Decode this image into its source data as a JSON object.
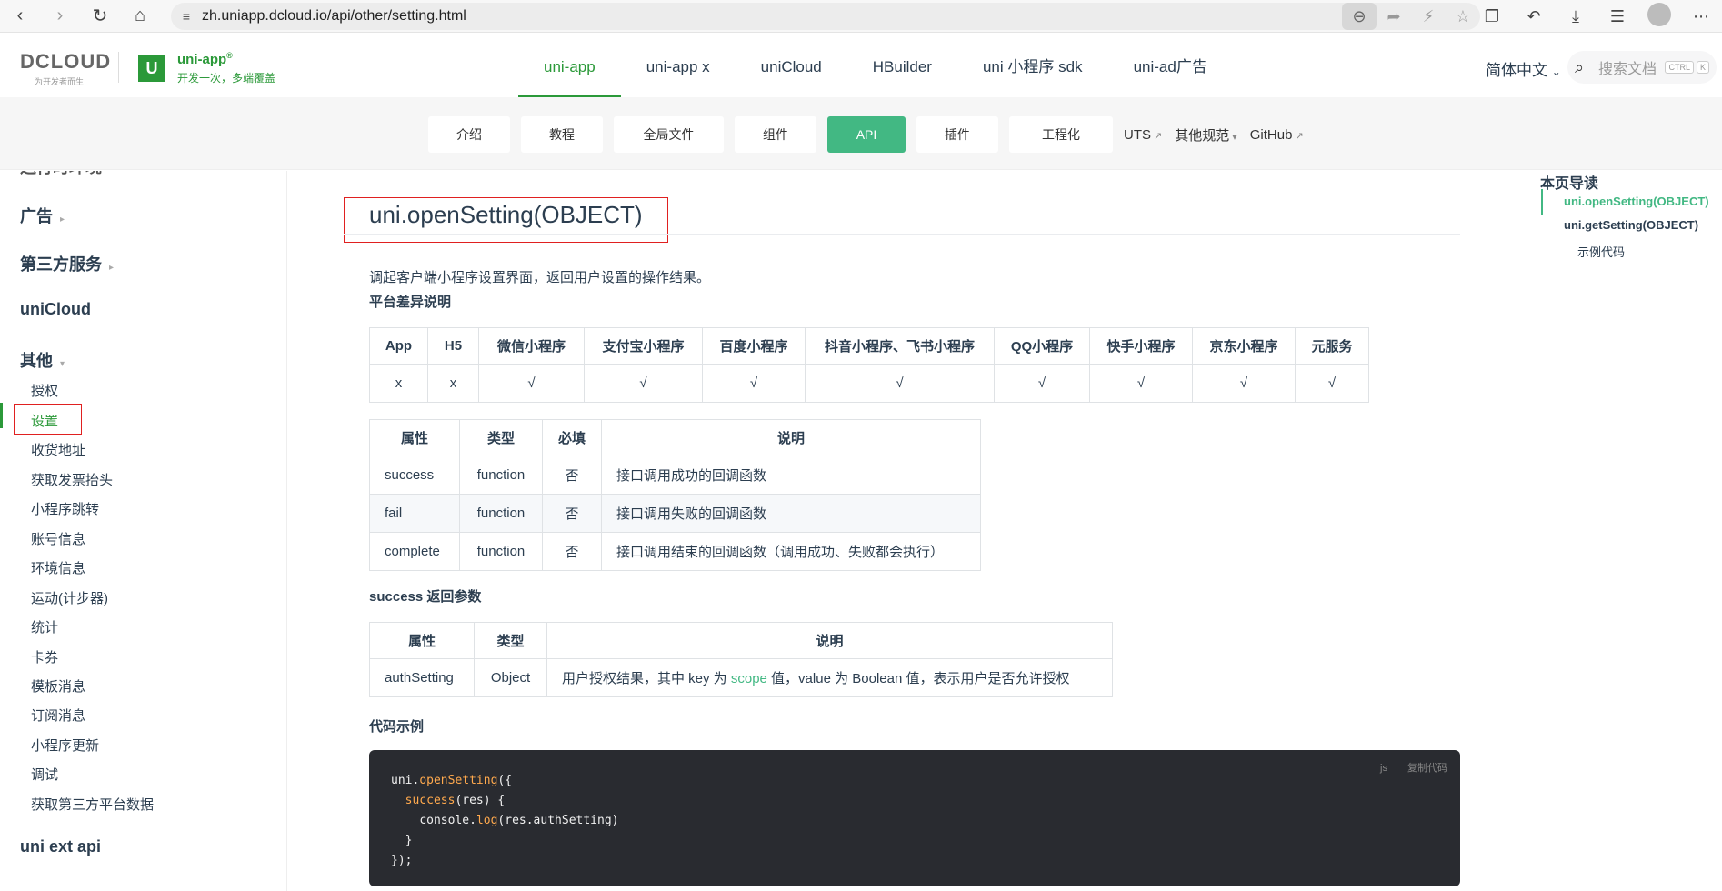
{
  "browser": {
    "url": "zh.uniapp.dcloud.io/api/other/setting.html"
  },
  "header": {
    "dcloud_logo": "DCLOUD",
    "dcloud_tagline": "为开发者而生",
    "product_name": "uni-app",
    "product_tagline": "开发一次，多端覆盖",
    "nav": [
      "uni-app",
      "uni-app x",
      "uniCloud",
      "HBuilder",
      "uni 小程序 sdk",
      "uni-ad广告"
    ],
    "language": "简体中文",
    "search_placeholder": "搜索文档",
    "kbd_ctrl": "CTRL",
    "kbd_k": "K"
  },
  "subnav": {
    "tabs": [
      "介绍",
      "教程",
      "全局文件",
      "组件",
      "API",
      "插件",
      "工程化"
    ],
    "links": [
      "UTS",
      "其他规范",
      "GitHub"
    ]
  },
  "sidebar": {
    "cut_item": "运行时环境",
    "groups": [
      "广告",
      "第三方服务",
      "uniCloud",
      "其他",
      "uni ext api"
    ],
    "items": [
      "授权",
      "设置",
      "收货地址",
      "获取发票抬头",
      "小程序跳转",
      "账号信息",
      "环境信息",
      "运动(计步器)",
      "统计",
      "卡券",
      "模板消息",
      "订阅消息",
      "小程序更新",
      "调试",
      "获取第三方平台数据"
    ]
  },
  "main": {
    "title": "uni.openSetting(OBJECT)",
    "description": "调起客户端小程序设置界面，返回用户设置的操作结果。",
    "platform_heading": "平台差异说明",
    "platform_table": {
      "headers": [
        "App",
        "H5",
        "微信小程序",
        "支付宝小程序",
        "百度小程序",
        "抖音小程序、飞书小程序",
        "QQ小程序",
        "快手小程序",
        "京东小程序",
        "元服务"
      ],
      "row": [
        "x",
        "x",
        "√",
        "√",
        "√",
        "√",
        "√",
        "√",
        "√",
        "√"
      ]
    },
    "params_table": {
      "headers": [
        "属性",
        "类型",
        "必填",
        "说明"
      ],
      "rows": [
        [
          "success",
          "function",
          "否",
          "接口调用成功的回调函数"
        ],
        [
          "fail",
          "function",
          "否",
          "接口调用失败的回调函数"
        ],
        [
          "complete",
          "function",
          "否",
          "接口调用结束的回调函数（调用成功、失败都会执行）"
        ]
      ]
    },
    "success_heading": "success 返回参数",
    "success_table": {
      "headers": [
        "属性",
        "类型",
        "说明"
      ],
      "row_name": "authSetting",
      "row_type": "Object",
      "desc_before": "用户授权结果，其中 key 为 ",
      "desc_code": "scope",
      "desc_after": " 值，value 为 Boolean 值，表示用户是否允许授权"
    },
    "code_heading": "代码示例",
    "code": {
      "lang": "js",
      "copy": "复制代码",
      "l1_obj": "uni.",
      "l1_fn": "openSetting",
      "l1_rest": "({",
      "l2_fn": "success",
      "l2_rest": "(res) {",
      "l3_obj": "console.",
      "l3_fn": "log",
      "l3_rest": "(res.authSetting)",
      "l4": "}",
      "l5": "});"
    }
  },
  "toc": {
    "title": "本页导读",
    "items": [
      "uni.openSetting(OBJECT)",
      "uni.getSetting(OBJECT)"
    ],
    "sub": "示例代码"
  },
  "colors": {
    "accent": "#2b9939",
    "api_tab": "#42b883",
    "highlight_box": "#e02020"
  }
}
